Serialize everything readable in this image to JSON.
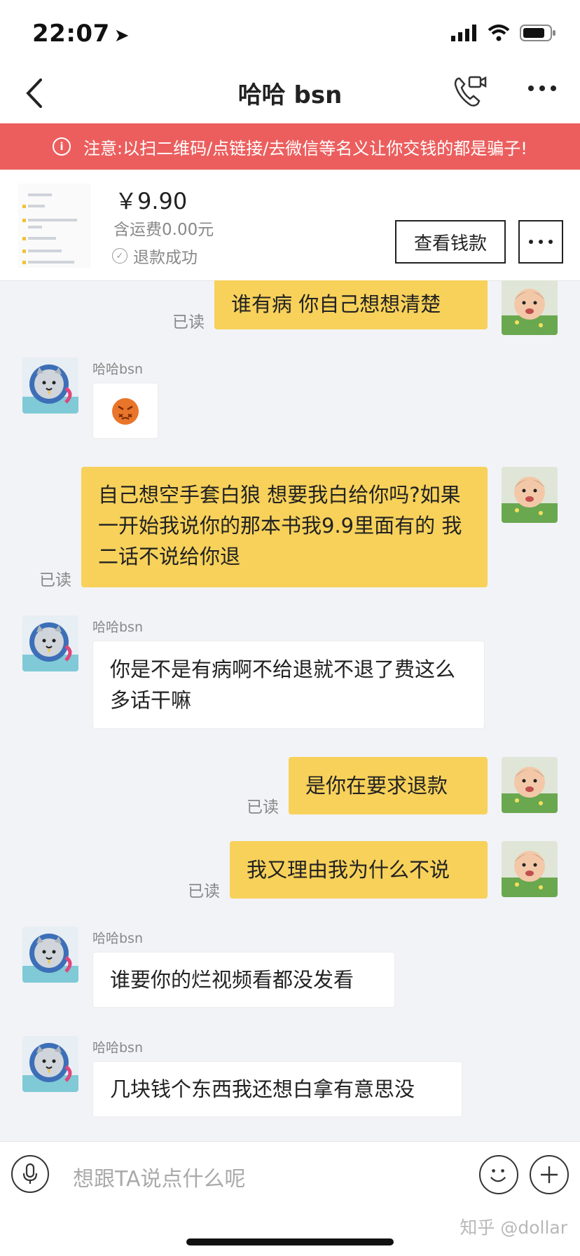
{
  "status_bar": {
    "time": "22:07"
  },
  "nav": {
    "title": "哈哈 bsn"
  },
  "warning": {
    "text": "注意:以扫二维码/点链接/去微信等名义让你交钱的都是骗子!"
  },
  "order": {
    "price": "￥9.90",
    "shipping": "含运费0.00元",
    "status": "退款成功",
    "view_button": "查看钱款"
  },
  "messages": [
    {
      "side": "mine",
      "text": "谁有病 你自己想想清楚",
      "read": "已读"
    },
    {
      "side": "theirs",
      "sender": "哈哈bsn",
      "emoji": "angry-face"
    },
    {
      "side": "mine",
      "text": "自己想空手套白狼 想要我白给你吗?如果一开始我说你的那本书我9.9里面有的 我二话不说给你退",
      "read": "已读"
    },
    {
      "side": "theirs",
      "sender": "哈哈bsn",
      "text": "你是不是有病啊不给退就不退了费这么多话干嘛"
    },
    {
      "side": "mine",
      "text": "是你在要求退款",
      "read": "已读"
    },
    {
      "side": "mine",
      "text": "我又理由我为什么不说",
      "read": "已读"
    },
    {
      "side": "theirs",
      "sender": "哈哈bsn",
      "text": "谁要你的烂视频看都没发看"
    },
    {
      "side": "theirs",
      "sender": "哈哈bsn",
      "text": "几块钱个东西我还想白拿有意思没"
    }
  ],
  "input": {
    "placeholder": "想跟TA说点什么呢"
  },
  "watermark": "知乎 @dollar",
  "colors": {
    "warning_bg": "#ec5e5e",
    "my_bubble": "#f7d15a",
    "chat_bg": "#f2f3f7"
  },
  "icons": [
    "back-arrow-icon",
    "video-call-icon",
    "more-dots-icon",
    "info-icon",
    "check-circle-icon",
    "microphone-icon",
    "emoji-icon",
    "plus-icon"
  ]
}
